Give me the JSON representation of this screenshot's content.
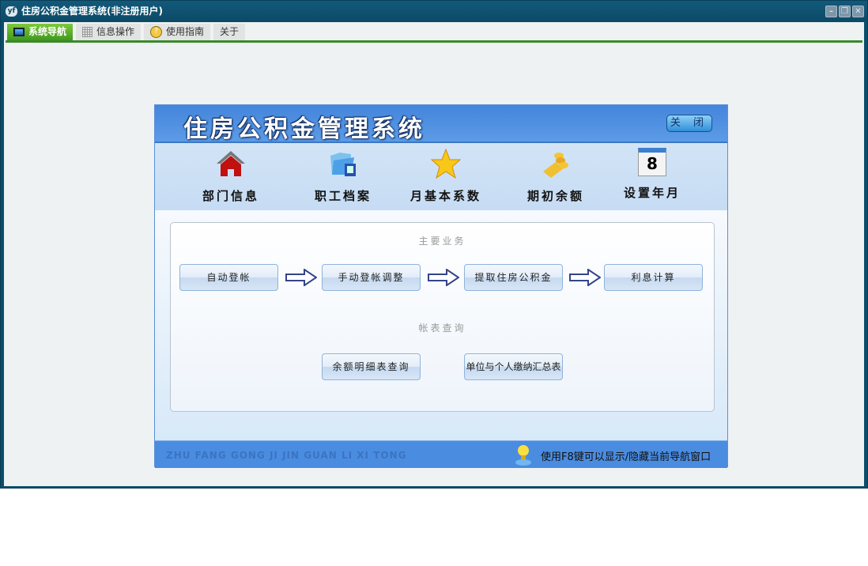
{
  "window": {
    "title": "住房公积金管理系统(非注册用户)",
    "app_icon": "yf",
    "controls": [
      "minimize",
      "restore",
      "close"
    ]
  },
  "tabs": [
    {
      "label": "系统导航",
      "icon": "monitor-icon",
      "active": true
    },
    {
      "label": "信息操作",
      "icon": "grid-icon"
    },
    {
      "label": "使用指南",
      "icon": "help-icon"
    },
    {
      "label": "关于"
    }
  ],
  "panel": {
    "title": "住房公积金管理系统",
    "close_label": "关 闭",
    "nav": [
      {
        "label": "部门信息",
        "icon": "house-icon"
      },
      {
        "label": "职工档案",
        "icon": "folder-icon"
      },
      {
        "label": "月基本系数",
        "icon": "star-icon"
      },
      {
        "label": "期初余额",
        "icon": "coins-icon"
      },
      {
        "label": "设置年月",
        "icon": "calendar-icon"
      }
    ],
    "calendar_day": "8",
    "main_title": "主要业务",
    "main_buttons": [
      "自动登帐",
      "手动登帐调整",
      "提取住房公积金",
      "利息计算"
    ],
    "query_title": "帐表查询",
    "query_buttons": [
      "余额明细表查询",
      "单位与个人缴纳汇总表"
    ],
    "pinyin": "ZHU FANG GONG JI JIN GUAN LI XI TONG",
    "tip": "使用F8键可以显示/隐藏当前导航窗口"
  }
}
